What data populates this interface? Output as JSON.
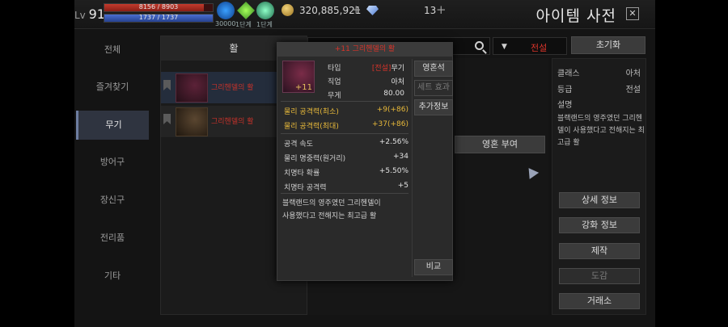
{
  "player": {
    "level_label": "Lv",
    "level": "91",
    "hp": "8156 / 8903",
    "hp_fraction": 0.916,
    "mp": "1737 / 1737",
    "mp_fraction": 1.0,
    "buffs": [
      {
        "name": "blue-wing-icon",
        "label": "30000"
      },
      {
        "name": "green-crystal-icon",
        "label": "1단계"
      },
      {
        "name": "green-gear-icon",
        "label": "1단계"
      }
    ],
    "silver": "320,885,921",
    "diamonds": "13"
  },
  "window": {
    "title": "아이템 사전",
    "close_icon": "close-icon"
  },
  "categories": [
    {
      "label": "전체",
      "active": false
    },
    {
      "label": "즐겨찾기",
      "active": false
    },
    {
      "label": "무기",
      "active": true
    },
    {
      "label": "방어구",
      "active": false
    },
    {
      "label": "장신구",
      "active": false
    },
    {
      "label": "전리품",
      "active": false
    },
    {
      "label": "기타",
      "active": false
    }
  ],
  "item_list": {
    "header": "활",
    "rows": [
      {
        "name": "그리헨델의 활"
      },
      {
        "name": "그리헨델의 활"
      }
    ]
  },
  "filters": {
    "grade_value": "전설",
    "reset_label": "초기화"
  },
  "tooltip": {
    "title": "+11 그리헨델의 활",
    "enhance": "+11",
    "type_label": "타입",
    "type_grade": "[전설]",
    "type_value": "무기",
    "job_label": "직업",
    "job_value": "아처",
    "weight_label": "무게",
    "weight_value": "80.00",
    "attack_min_label": "물리 공격력(최소)",
    "attack_min_value": "+9(+86)",
    "attack_max_label": "물리 공격력(최대)",
    "attack_max_value": "+37(+86)",
    "stats": [
      {
        "label": "공격 속도",
        "value": "+2.56%"
      },
      {
        "label": "물리 명중력(원거리)",
        "value": "+34"
      },
      {
        "label": "치명타 확률",
        "value": "+5.50%"
      },
      {
        "label": "치명타 공격력",
        "value": "+5"
      }
    ],
    "description": "블랙랜드의 영주였던 그리헨델이\n사용했다고 전해지는 최고급 활",
    "side_buttons": [
      "영혼석",
      "세트 효과",
      "추가정보"
    ],
    "compare_label": "비교"
  },
  "soul_button": "영혼 부여",
  "detail": {
    "class_label": "클래스",
    "class_value": "아처",
    "grade_label": "등급",
    "grade_value": "전설",
    "desc_label": "설명",
    "desc_text": "블랙랜드의 영주였던 그리헨델이 사용했다고 전해지는 최고급 활",
    "buttons": [
      "상세 정보",
      "강화 정보",
      "제작",
      "도감",
      "거래소"
    ]
  }
}
